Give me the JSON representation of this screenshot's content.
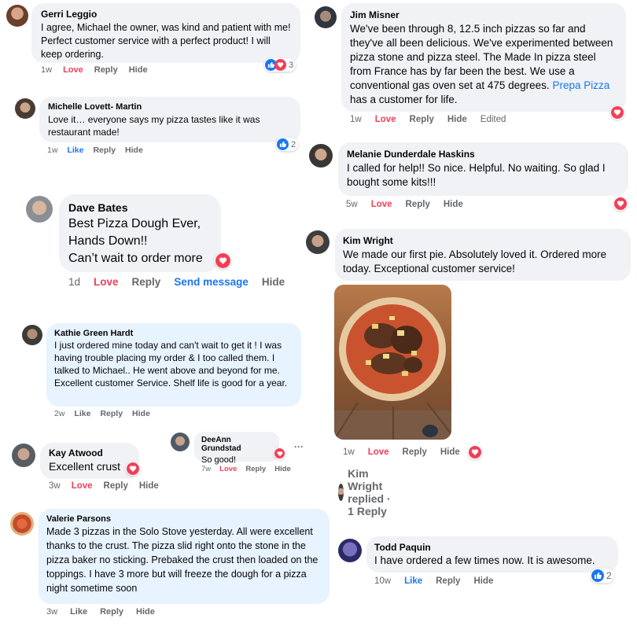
{
  "colors": {
    "love": "#f33e58",
    "like": "#1877f2",
    "meta": "#65676b",
    "bubble": "#f0f2f5",
    "bubble_highlight": "#e7f3ff"
  },
  "comments": {
    "gerri": {
      "name": "Gerri Leggio",
      "text": "I agree, Michael the owner, was kind and patient with me! Perfect customer service with a perfect product! I will keep ordering.",
      "time": "1w",
      "love": "Love",
      "reply": "Reply",
      "hide": "Hide",
      "reaction_count": "3",
      "reaction_icons": [
        "like-icon",
        "love-icon"
      ]
    },
    "michelle": {
      "name": "Michelle Lovett- Martin",
      "text": "Love it… everyone says my pizza tastes like it was restaurant made!",
      "time": "1w",
      "like": "Like",
      "reply": "Reply",
      "hide": "Hide",
      "reaction_count": "2",
      "reaction_icons": [
        "like-icon"
      ]
    },
    "dave": {
      "name": "Dave Bates",
      "line1": "Best Pizza Dough Ever,",
      "line2": "Hands Down!!",
      "line3": "Can’t wait to order more",
      "time": "1d",
      "love": "Love",
      "reply": "Reply",
      "send": "Send message",
      "hide": "Hide",
      "reaction_icons": [
        "love-icon"
      ]
    },
    "kathie": {
      "name": "Kathie Green Hardt",
      "text": "I just ordered mine today and can't wait to get it ! I was having trouble placing my order & I too called them. I talked to Michael.. He went above and beyond for me. Excellent customer Service. Shelf life is good for a year.",
      "time": "2w",
      "like": "Like",
      "reply": "Reply",
      "hide": "Hide"
    },
    "kay": {
      "name": "Kay Atwood",
      "text": "Excellent crust",
      "time": "3w",
      "love": "Love",
      "reply": "Reply",
      "hide": "Hide",
      "reaction_icons": [
        "love-icon"
      ]
    },
    "deeann": {
      "name": "DeeAnn Grundstad",
      "text": "So good!",
      "time": "7w",
      "love": "Love",
      "reply": "Reply",
      "hide": "Hide",
      "more": "···",
      "reaction_icons": [
        "love-icon"
      ]
    },
    "valerie": {
      "name": "Valerie Parsons",
      "text": "Made 3 pizzas in the Solo Stove yesterday. All were excellent thanks to the crust. The pizza slid right onto the stone in the pizza baker no sticking. Prebaked the crust then loaded on the toppings. I have 3 more but will freeze the dough for a pizza night sometime soon",
      "time": "3w",
      "like": "Like",
      "reply": "Reply",
      "hide": "Hide"
    },
    "jim": {
      "name": "Jim Misner",
      "text": "We've been through 8, 12.5 inch pizzas so far and they've all been delicious. We've experimented between pizza stone and pizza steel. The Made In pizza steel from France has by far been the best. We use a conventional gas oven set at 475 degrees.",
      "link": "Prepa Pizza",
      "text_end": "has a customer for life.",
      "time": "1w",
      "love": "Love",
      "reply": "Reply",
      "hide": "Hide",
      "edited": "Edited",
      "reaction_icons": [
        "love-icon"
      ]
    },
    "melanie": {
      "name": "Melanie Dunderdale Haskins",
      "text": "I called for help!! So nice. Helpful. No waiting. So glad I bought some kits!!!",
      "time": "5w",
      "love": "Love",
      "reply": "Reply",
      "hide": "Hide",
      "reaction_icons": [
        "love-icon"
      ]
    },
    "kim": {
      "name": "Kim Wright",
      "text": "We made our first pie. Absolutely loved it. Ordered more today. Exceptional customer service!",
      "time": "1w",
      "love": "Love",
      "reply": "Reply",
      "hide": "Hide",
      "replied": "Kim Wright replied · 1 Reply",
      "reaction_icons": [
        "love-icon"
      ]
    },
    "todd": {
      "name": "Todd Paquin",
      "text": "I have ordered a few times now. It is awesome.",
      "time": "10w",
      "like": "Like",
      "reply": "Reply",
      "hide": "Hide",
      "reaction_count": "2",
      "reaction_icons": [
        "like-icon"
      ]
    }
  }
}
